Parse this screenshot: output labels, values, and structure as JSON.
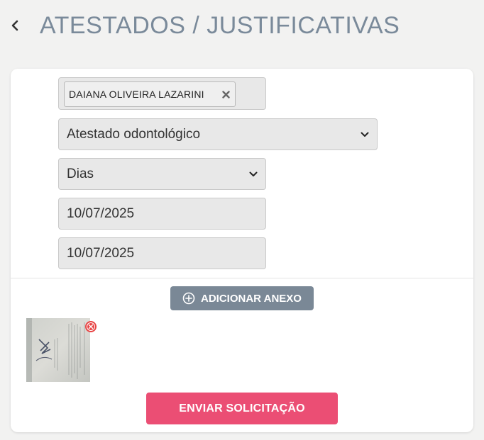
{
  "header": {
    "back_icon": "chevron-left-icon",
    "title": "ATESTADOS / JUSTIFICATIVAS"
  },
  "form": {
    "employee_tags": [
      {
        "label": "DAIANA OLIVEIRA LAZARINI",
        "remove_icon": "x-icon"
      }
    ],
    "certificate_type": {
      "selected": "Atestado odontológico"
    },
    "duration_unit": {
      "selected": "Dias"
    },
    "start_date": {
      "value": "10/07/2025"
    },
    "end_date": {
      "value": "10/07/2025"
    },
    "attach_button": {
      "label": "ADICIONAR ANEXO",
      "icon": "plus-circle-icon"
    },
    "attachments": [
      {
        "type": "image",
        "remove_icon": "remove-circle-icon"
      }
    ],
    "submit_button": {
      "label": "ENVIAR SOLICITAÇÃO"
    }
  },
  "colors": {
    "title": "#7a8a9a",
    "attach_button_bg": "#7a8896",
    "submit_button_bg": "#eb4e74",
    "remove_icon": "#e84545"
  }
}
